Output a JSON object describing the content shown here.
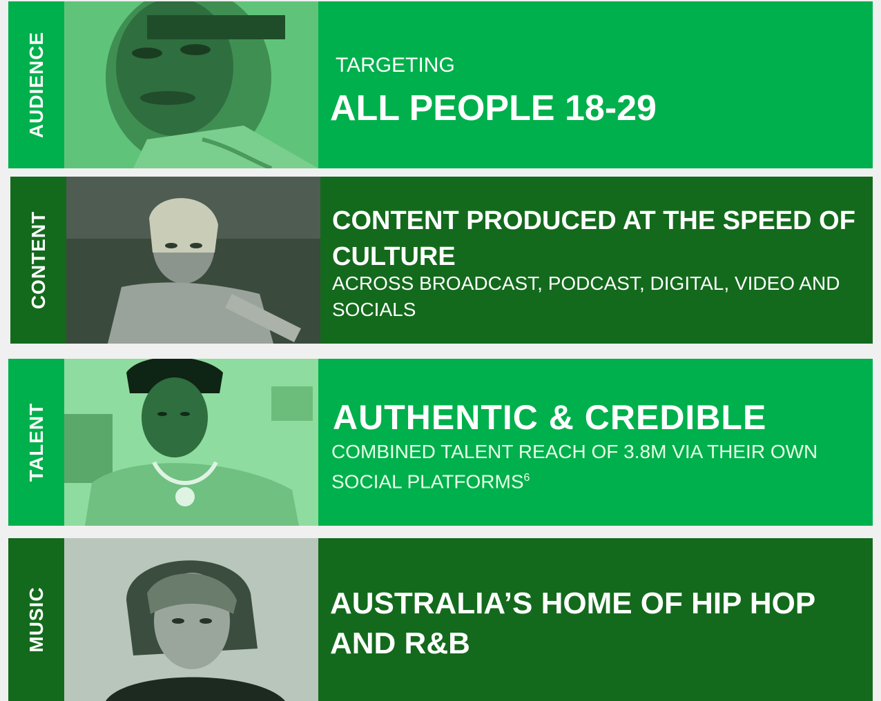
{
  "rows": [
    {
      "side_label": "AUDIENCE",
      "kicker": "TARGETING",
      "headline": "ALL PEOPLE 18-29"
    },
    {
      "side_label": "CONTENT",
      "headline": "CONTENT PRODUCED AT THE SPEED OF CULTURE",
      "sub": "ACROSS BROADCAST, PODCAST, DIGITAL, VIDEO AND SOCIALS"
    },
    {
      "side_label": "TALENT",
      "headline": "AUTHENTIC & CREDIBLE",
      "sub": "COMBINED TALENT REACH OF 3.8M VIA THEIR OWN SOCIAL PLATFORMS",
      "footnote": "6"
    },
    {
      "side_label": "MUSIC",
      "headline": "AUSTRALIA’S HOME OF HIP HOP AND R&B"
    }
  ],
  "colors": {
    "bright_green": "#00b04c",
    "dark_green": "#136a1c",
    "background": "#f0f0f0"
  }
}
